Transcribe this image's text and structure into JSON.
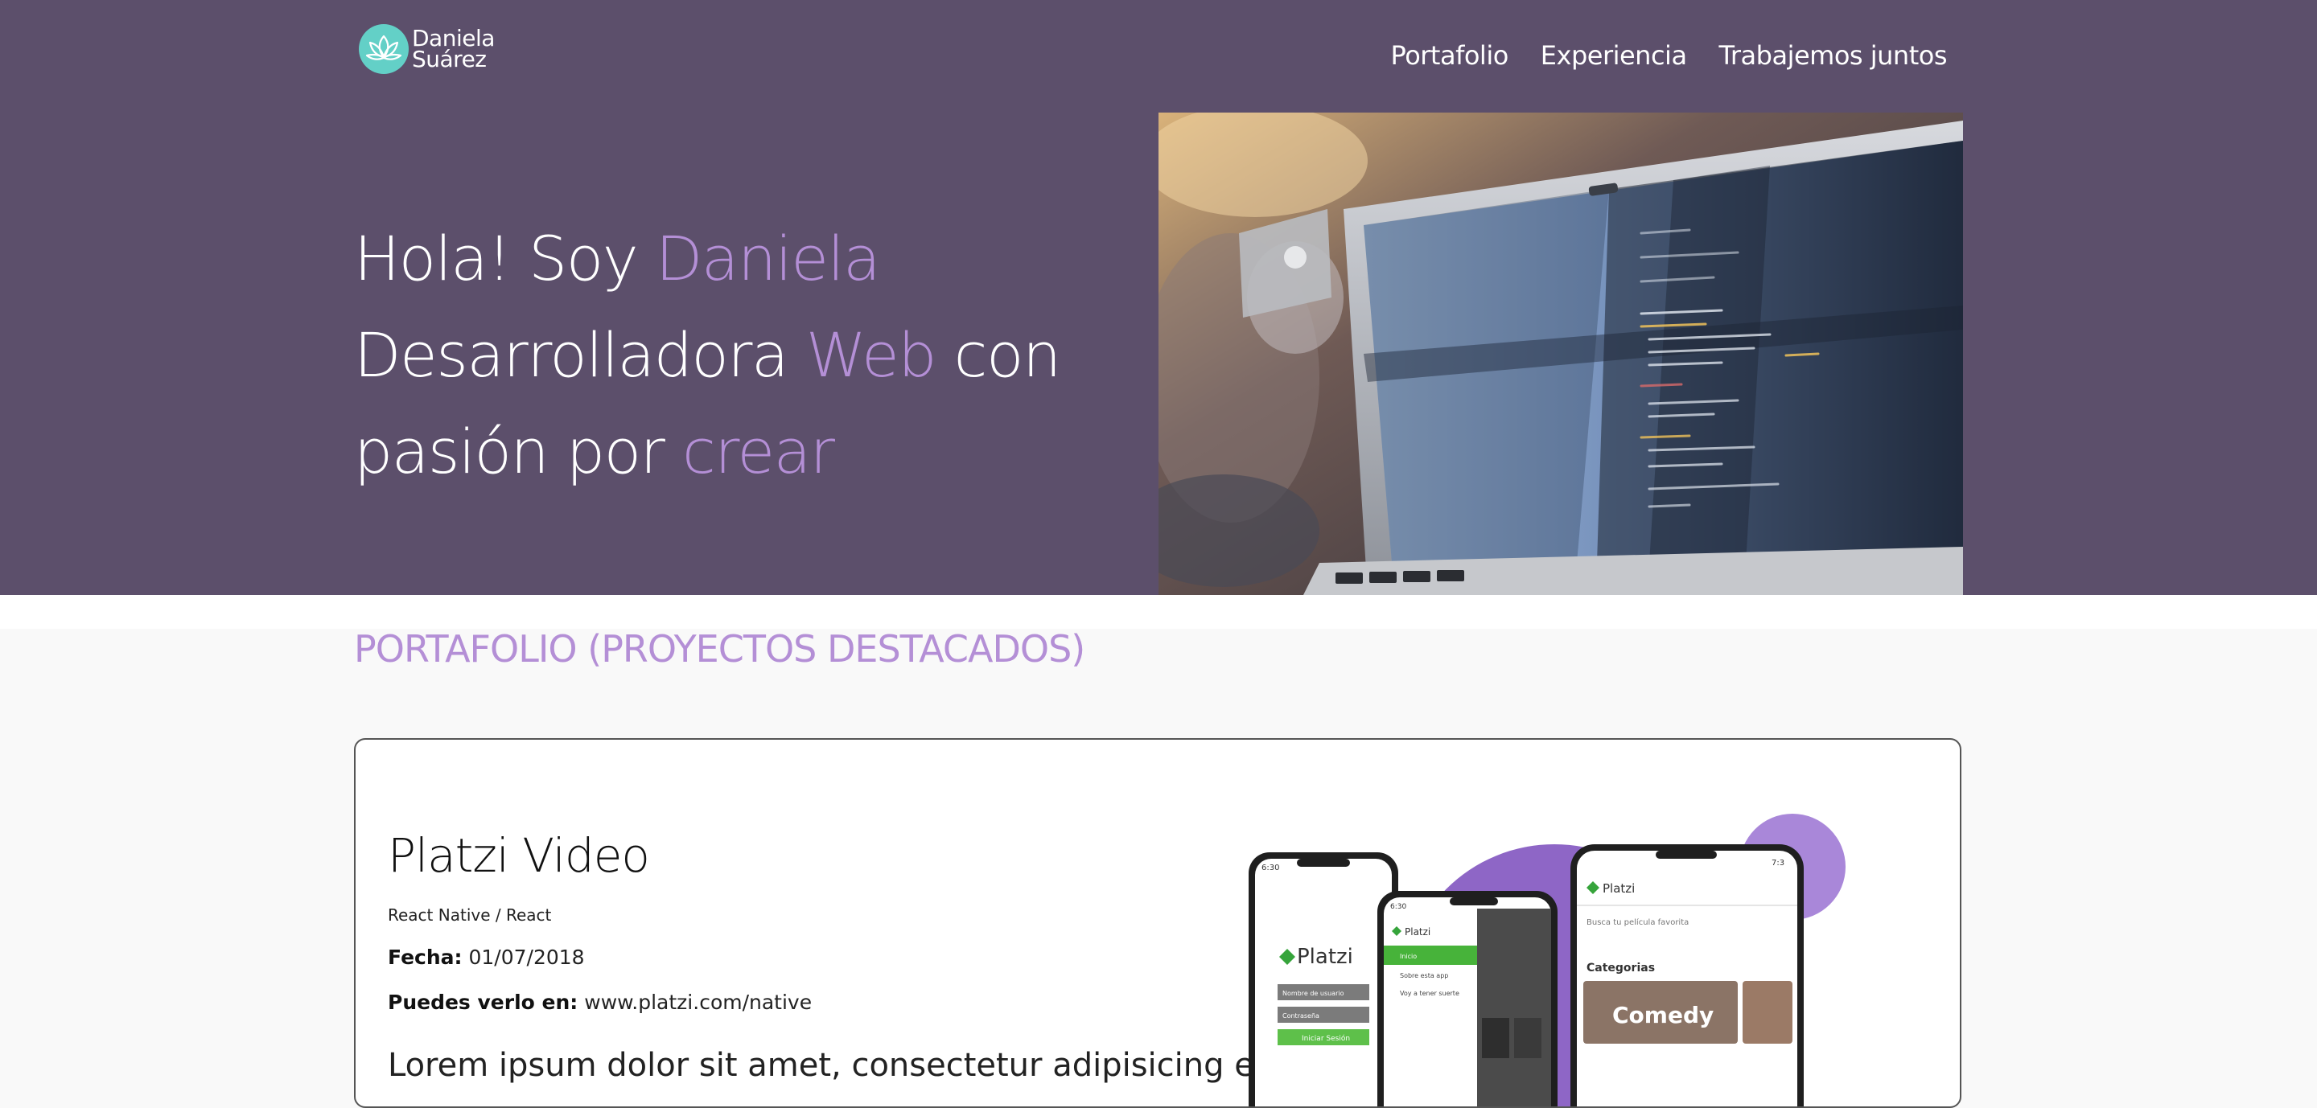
{
  "brand": {
    "first_name": "Daniela",
    "last_name": "Suárez",
    "logo_icon": "lotus-icon",
    "logo_color": "#63d0c7"
  },
  "nav": {
    "items": [
      "Portafolio",
      "Experiencia",
      "Trabajemos juntos"
    ]
  },
  "hero": {
    "line1_prefix": "Hola! Soy ",
    "line1_accent": "Daniela",
    "line2_prefix": "Desarrolladora ",
    "line2_accent": "Web",
    "line2_suffix": " con",
    "line3_prefix": "pasión por ",
    "line3_accent": "crear",
    "background_color": "#5c4f6b",
    "accent_color": "#b48fd6",
    "image_icon": "laptop-code-photo"
  },
  "portfolio": {
    "title": "PORTAFOLIO (PROYECTOS DESTACADOS)",
    "project": {
      "title": "Platzi Video",
      "tech": "React Native / React",
      "date_label": "Fecha:",
      "date_value": "01/07/2018",
      "link_label": "Puedes verlo en:",
      "link_value": "www.platzi.com/native",
      "description": "Lorem ipsum dolor sit amet, consectetur adipisicing elit",
      "screens": {
        "phone1_brand": "Platzi",
        "phone1_field1": "Nombre de usuario",
        "phone1_field2": "Contraseña",
        "phone1_button": "Iniciar Sesión",
        "phone2_brand": "Platzi",
        "phone2_menu": [
          "Inicio",
          "Sobre esta app",
          "Voy a tener suerte"
        ],
        "phone2_time": "6:30",
        "phone3_brand": "Platzi",
        "phone3_search": "Busca tu película favorita",
        "phone3_section": "Categorias",
        "phone3_category": "Comedy",
        "phone3_time": "7:3"
      }
    }
  }
}
